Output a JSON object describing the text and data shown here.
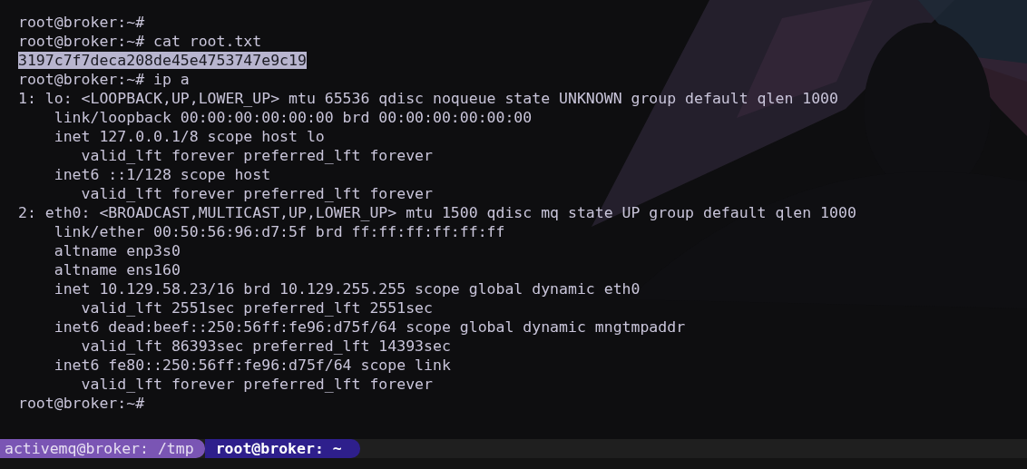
{
  "terminal": {
    "lines": [
      {
        "text": "root@broker:~#",
        "selected": false
      },
      {
        "text": "root@broker:~# cat root.txt",
        "selected": false
      },
      {
        "text": "3197c7f7deca208de45e4753747e9c19",
        "selected": true
      },
      {
        "text": "root@broker:~# ip a",
        "selected": false
      },
      {
        "text": "1: lo: <LOOPBACK,UP,LOWER_UP> mtu 65536 qdisc noqueue state UNKNOWN group default qlen 1000",
        "selected": false
      },
      {
        "text": "    link/loopback 00:00:00:00:00:00 brd 00:00:00:00:00:00",
        "selected": false
      },
      {
        "text": "    inet 127.0.0.1/8 scope host lo",
        "selected": false
      },
      {
        "text": "       valid_lft forever preferred_lft forever",
        "selected": false
      },
      {
        "text": "    inet6 ::1/128 scope host",
        "selected": false
      },
      {
        "text": "       valid_lft forever preferred_lft forever",
        "selected": false
      },
      {
        "text": "2: eth0: <BROADCAST,MULTICAST,UP,LOWER_UP> mtu 1500 qdisc mq state UP group default qlen 1000",
        "selected": false
      },
      {
        "text": "    link/ether 00:50:56:96:d7:5f brd ff:ff:ff:ff:ff:ff",
        "selected": false
      },
      {
        "text": "    altname enp3s0",
        "selected": false
      },
      {
        "text": "    altname ens160",
        "selected": false
      },
      {
        "text": "    inet 10.129.58.23/16 brd 10.129.255.255 scope global dynamic eth0",
        "selected": false
      },
      {
        "text": "       valid_lft 2551sec preferred_lft 2551sec",
        "selected": false
      },
      {
        "text": "    inet6 dead:beef::250:56ff:fe96:d75f/64 scope global dynamic mngtmpaddr",
        "selected": false
      },
      {
        "text": "       valid_lft 86393sec preferred_lft 14393sec",
        "selected": false
      },
      {
        "text": "    inet6 fe80::250:56ff:fe96:d75f/64 scope link",
        "selected": false
      },
      {
        "text": "       valid_lft forever preferred_lft forever",
        "selected": false
      },
      {
        "text": "root@broker:~#",
        "selected": false
      }
    ]
  },
  "tabs": [
    {
      "label": "activemq@broker: /tmp",
      "selected": false
    },
    {
      "label": "root@broker: ~",
      "selected": true
    }
  ]
}
